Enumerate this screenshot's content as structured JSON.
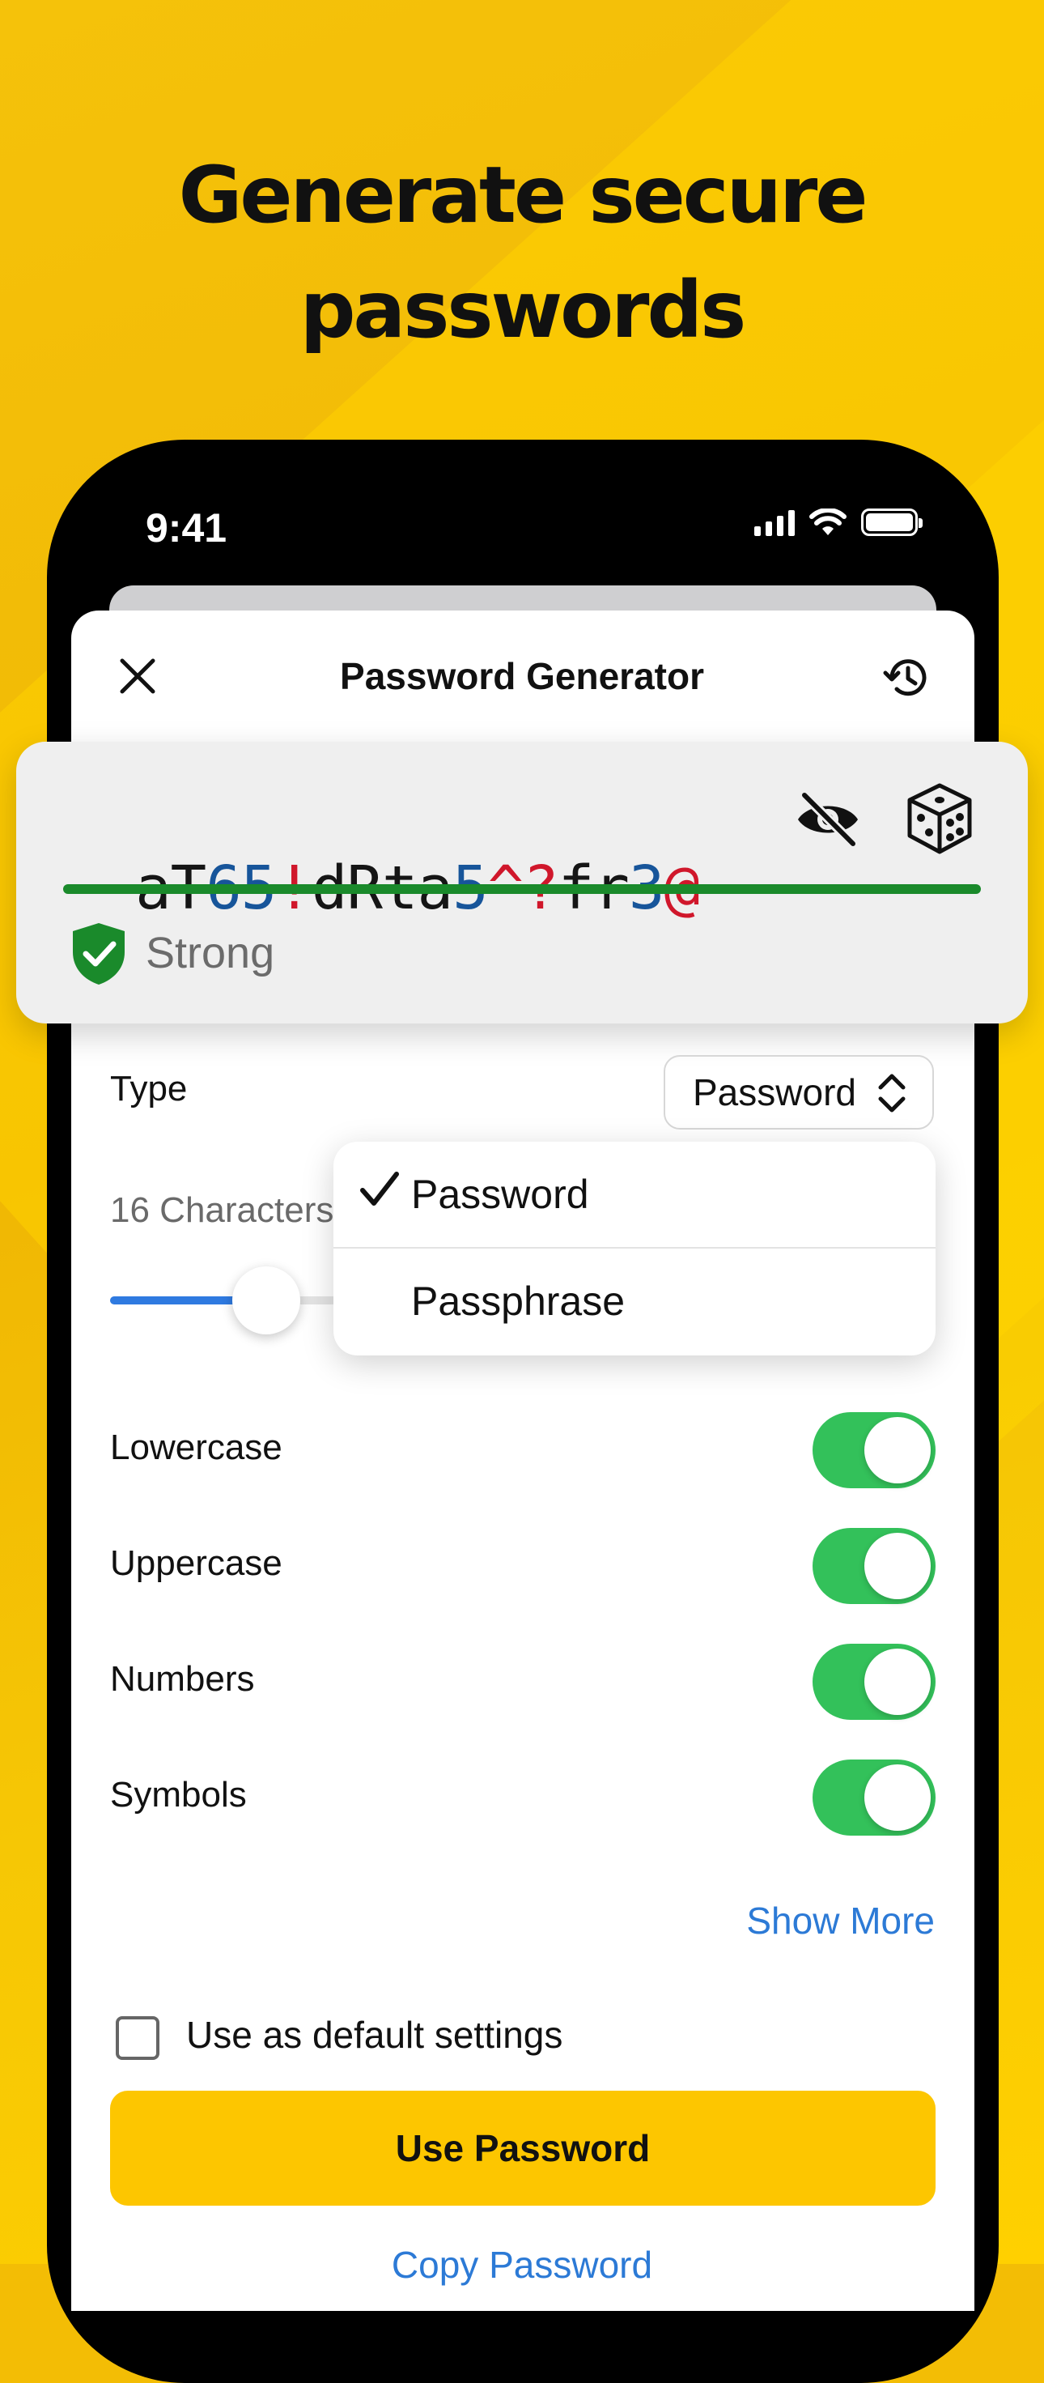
{
  "headline": {
    "line1": "Generate secure",
    "line2": "passwords"
  },
  "status_bar": {
    "time": "9:41"
  },
  "header": {
    "title": "Password Generator",
    "close_icon": "close-icon",
    "history_icon": "history-icon"
  },
  "password": {
    "segments": [
      {
        "text": "aT",
        "color": "black"
      },
      {
        "text": "65",
        "color": "blue"
      },
      {
        "text": "!",
        "color": "red"
      },
      {
        "text": "dRta",
        "color": "black"
      },
      {
        "text": "5",
        "color": "blue"
      },
      {
        "text": "^?",
        "color": "red"
      },
      {
        "text": "fr",
        "color": "black"
      },
      {
        "text": "3",
        "color": "blue"
      },
      {
        "text": "@",
        "color": "red"
      }
    ],
    "strength_label": "Strong",
    "strength_level": 1.0,
    "strength_color": "#1a8a2b"
  },
  "type_row": {
    "label": "Type",
    "selected": "Password"
  },
  "dropdown": {
    "options": [
      {
        "label": "Password",
        "checked": true
      },
      {
        "label": "Passphrase",
        "checked": false
      }
    ]
  },
  "length": {
    "label": "16 Characters",
    "value": 16,
    "slider_fraction": 0.16
  },
  "toggles": [
    {
      "label": "Lowercase",
      "on": true
    },
    {
      "label": "Uppercase",
      "on": true
    },
    {
      "label": "Numbers",
      "on": true
    },
    {
      "label": "Symbols",
      "on": true
    }
  ],
  "show_more": "Show More",
  "default_settings": {
    "label": "Use as default settings",
    "checked": false
  },
  "use_button": "Use Password",
  "copy_link": "Copy Password",
  "colors": {
    "accent_yellow": "#fdc600",
    "toggle_green": "#33c15a",
    "link_blue": "#2c7ad6"
  }
}
